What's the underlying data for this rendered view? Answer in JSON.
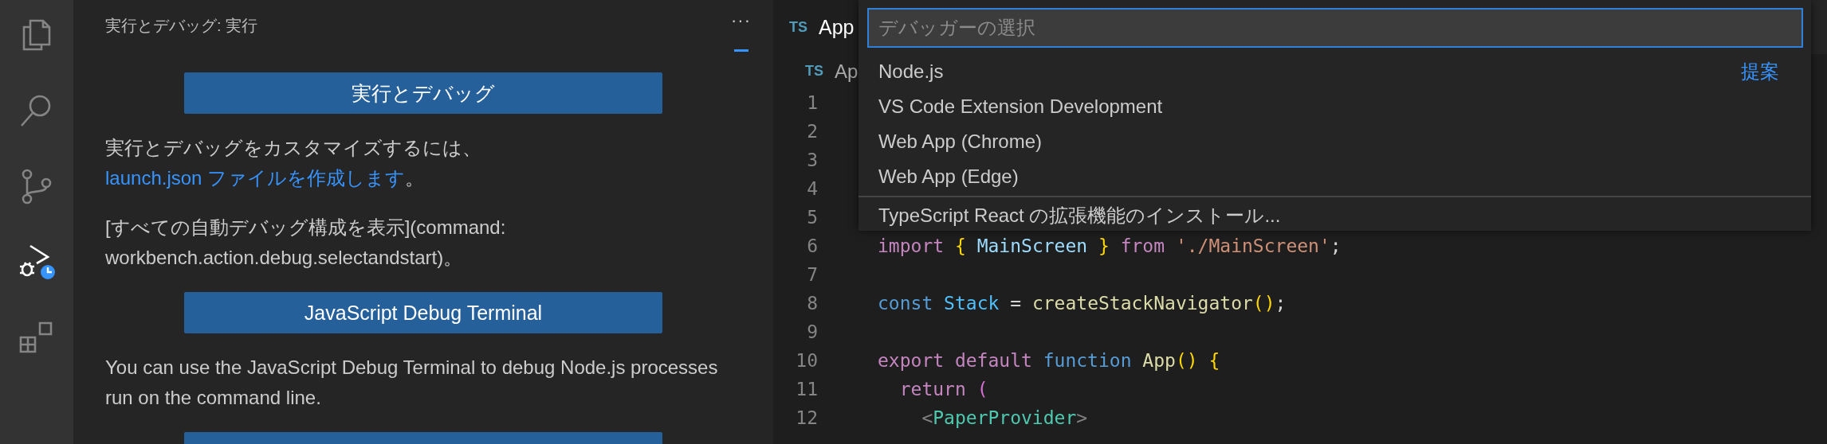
{
  "activity_bar": [
    {
      "selected": false
    },
    {
      "selected": false
    },
    {
      "selected": false
    },
    {
      "selected": true
    },
    {
      "selected": false
    }
  ],
  "sidebar": {
    "title": "実行とデバッグ: 実行",
    "more": "···",
    "blocks": [
      {
        "kind": "button",
        "label": "実行とデバッグ"
      },
      {
        "kind": "paragraph",
        "parts": [
          {
            "kind": "text",
            "text": "実行とデバッグをカスタマイズするには、"
          },
          {
            "kind": "link",
            "text": "launch.json ファイルを作成します"
          },
          {
            "kind": "text",
            "text": "。"
          }
        ]
      },
      {
        "kind": "paragraph",
        "parts": [
          {
            "kind": "text",
            "text": "[すべての自動デバッグ構成を表示](command: workbench.action.debug.selectandstart)。"
          }
        ]
      },
      {
        "kind": "button",
        "label": "JavaScript Debug Terminal"
      },
      {
        "kind": "paragraph",
        "parts": [
          {
            "kind": "text",
            "text": "You can use the JavaScript Debug Terminal to debug Node.js processes run on the command line."
          }
        ]
      },
      {
        "kind": "button_edge"
      }
    ]
  },
  "editor": {
    "tab": {
      "icon": "TS",
      "label": "App"
    },
    "breadcrumb": {
      "icon": "TS",
      "label": "Ap"
    },
    "lines": [
      {
        "number": "1"
      },
      {
        "number": "2"
      },
      {
        "number": "3"
      },
      {
        "number": "4"
      },
      {
        "number": "5"
      },
      {
        "number": "6",
        "tokens": [
          {
            "kind": "keyword",
            "text": "import "
          },
          {
            "kind": "bracket",
            "text": "{"
          },
          {
            "kind": "variable",
            "text": " MainScreen "
          },
          {
            "kind": "bracket",
            "text": "} "
          },
          {
            "kind": "keyword",
            "text": "from "
          },
          {
            "kind": "string",
            "text": "'./MainScreen'"
          },
          {
            "kind": "plain",
            "text": ";"
          }
        ]
      },
      {
        "number": "7"
      },
      {
        "number": "8",
        "tokens": [
          {
            "kind": "storage",
            "text": "const "
          },
          {
            "kind": "constant",
            "text": "Stack"
          },
          {
            "kind": "plain",
            "text": " = "
          },
          {
            "kind": "function",
            "text": "createStackNavigator"
          },
          {
            "kind": "bracket",
            "text": "()"
          },
          {
            "kind": "plain",
            "text": ";"
          }
        ]
      },
      {
        "number": "9"
      },
      {
        "number": "10",
        "tokens": [
          {
            "kind": "keyword",
            "text": "export default "
          },
          {
            "kind": "storage",
            "text": "function "
          },
          {
            "kind": "function",
            "text": "App"
          },
          {
            "kind": "bracket",
            "text": "() {"
          }
        ]
      },
      {
        "number": "11",
        "tokens": [
          {
            "kind": "keyword",
            "text": "  return "
          },
          {
            "kind": "bracket2",
            "text": "("
          }
        ]
      },
      {
        "number": "12",
        "tokens": [
          {
            "kind": "tagpunct",
            "text": "    <"
          },
          {
            "kind": "tag",
            "text": "PaperProvider"
          },
          {
            "kind": "tagpunct",
            "text": ">"
          }
        ]
      }
    ]
  },
  "quick_pick": {
    "placeholder": "デバッガーの選択",
    "items": [
      {
        "label": "Node.js",
        "badge": "提案"
      },
      {
        "label": "VS Code Extension Development"
      },
      {
        "label": "Web App (Chrome)"
      },
      {
        "label": "Web App (Edge)"
      },
      {
        "label": "TypeScript React の拡張機能のインストール...",
        "separator": true
      }
    ]
  }
}
